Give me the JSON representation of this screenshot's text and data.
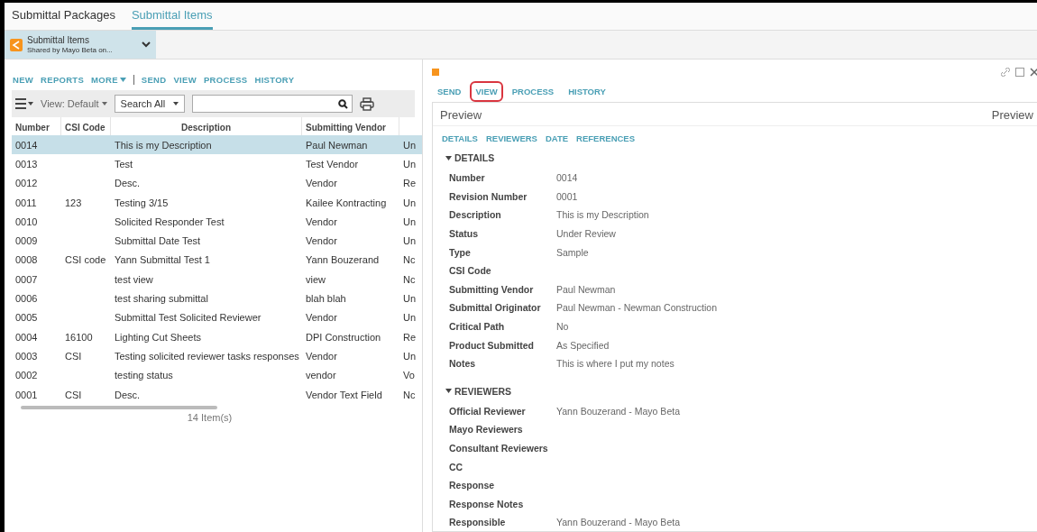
{
  "tabs": [
    {
      "label": "Submittal Packages",
      "selected": false
    },
    {
      "label": "Submittal Items",
      "selected": true
    }
  ],
  "shared": {
    "title": "Submittal Items",
    "subtitle": "Shared by Mayo Beta on..."
  },
  "left_actions": [
    {
      "label": "NEW",
      "kind": "link"
    },
    {
      "label": "REPORTS",
      "kind": "link"
    },
    {
      "label": "MORE",
      "kind": "menu"
    },
    {
      "label": "SEND",
      "kind": "link"
    },
    {
      "label": "VIEW",
      "kind": "link"
    },
    {
      "label": "PROCESS",
      "kind": "link"
    },
    {
      "label": "HISTORY",
      "kind": "link"
    }
  ],
  "toolbar": {
    "view": "View: Default",
    "search_scope": "Search All"
  },
  "table": {
    "columns": [
      "Number",
      "CSI Code",
      "Description",
      "Submitting Vendor"
    ],
    "rows": [
      {
        "cells": [
          "0014",
          null,
          "This is my Description",
          "Paul Newman",
          "Un"
        ],
        "selected": true
      },
      {
        "cells": [
          "0013",
          null,
          "Test",
          "Test Vendor",
          "Un"
        ],
        "selected": false
      },
      {
        "cells": [
          "0012",
          null,
          "Desc.",
          "Vendor",
          "Re"
        ],
        "selected": false
      },
      {
        "cells": [
          "0011",
          "123",
          "Testing 3/15",
          "Kailee Kontracting",
          "Un"
        ],
        "selected": false
      },
      {
        "cells": [
          "0010",
          null,
          "Solicited Responder Test",
          "Vendor",
          "Un"
        ],
        "selected": false
      },
      {
        "cells": [
          "0009",
          null,
          "Submittal Date Test",
          "Vendor",
          "Un"
        ],
        "selected": false
      },
      {
        "cells": [
          "0008",
          "CSI code",
          "Yann Submittal Test 1",
          "Yann Bouzerand",
          "Nc"
        ],
        "selected": false
      },
      {
        "cells": [
          "0007",
          null,
          "test view",
          "view",
          "Nc"
        ],
        "selected": false
      },
      {
        "cells": [
          "0006",
          null,
          "test sharing submittal",
          "blah blah",
          "Un"
        ],
        "selected": false
      },
      {
        "cells": [
          "0005",
          null,
          "Submittal Test Solicited Reviewer",
          "Vendor",
          "Un"
        ],
        "selected": false
      },
      {
        "cells": [
          "0004",
          "16100",
          "Lighting Cut Sheets",
          "DPI Construction",
          "Re"
        ],
        "selected": false
      },
      {
        "cells": [
          "0003",
          "CSI",
          "Testing solicited reviewer tasks responses",
          "Vendor",
          "Un"
        ],
        "selected": false
      },
      {
        "cells": [
          "0002",
          null,
          "testing status",
          "vendor",
          "Vo"
        ],
        "selected": false
      },
      {
        "cells": [
          "0001",
          "CSI",
          "Desc.",
          "Vendor Text Field",
          "Nc"
        ],
        "selected": false
      }
    ],
    "count": "14 Item(s)"
  },
  "right_actions": [
    {
      "label": "SEND",
      "highlighted": false
    },
    {
      "label": "VIEW",
      "highlighted": true
    },
    {
      "label": "PROCESS",
      "highlighted": false
    },
    {
      "label": "HISTORY",
      "highlighted": false
    }
  ],
  "preview": {
    "title": "Preview",
    "title_right": "Preview",
    "anchors": [
      "DETAILS",
      "REVIEWERS",
      "DATE",
      "REFERENCES"
    ],
    "sections": [
      {
        "title": "DETAILS",
        "expanded": true,
        "fields": [
          {
            "label": "Number",
            "value": "0014"
          },
          {
            "label": "Revision Number",
            "value": "0001"
          },
          {
            "label": "Description",
            "value": "This is my Description"
          },
          {
            "label": "Status",
            "value": "Under Review"
          },
          {
            "label": "Type",
            "value": "Sample"
          },
          {
            "label": "CSI Code"
          },
          {
            "label": "Submitting Vendor",
            "value": "Paul Newman"
          },
          {
            "label": "Submittal Originator",
            "value": "Paul Newman - Newman Construction"
          },
          {
            "label": "Critical Path",
            "value": "No"
          },
          {
            "label": "Product Submitted",
            "value": "As Specified"
          },
          {
            "label": "Notes",
            "value": "This is where I put my notes"
          }
        ]
      },
      {
        "title": "REVIEWERS",
        "expanded": true,
        "fields": [
          {
            "label": "Official Reviewer",
            "value": "Yann Bouzerand - Mayo Beta"
          },
          {
            "label": "Mayo Reviewers"
          },
          {
            "label": "Consultant Reviewers"
          },
          {
            "label": "CC"
          },
          {
            "label": "Response"
          },
          {
            "label": "Response Notes"
          },
          {
            "label": "Responsible",
            "value": "Yann Bouzerand - Mayo Beta"
          }
        ]
      }
    ]
  }
}
